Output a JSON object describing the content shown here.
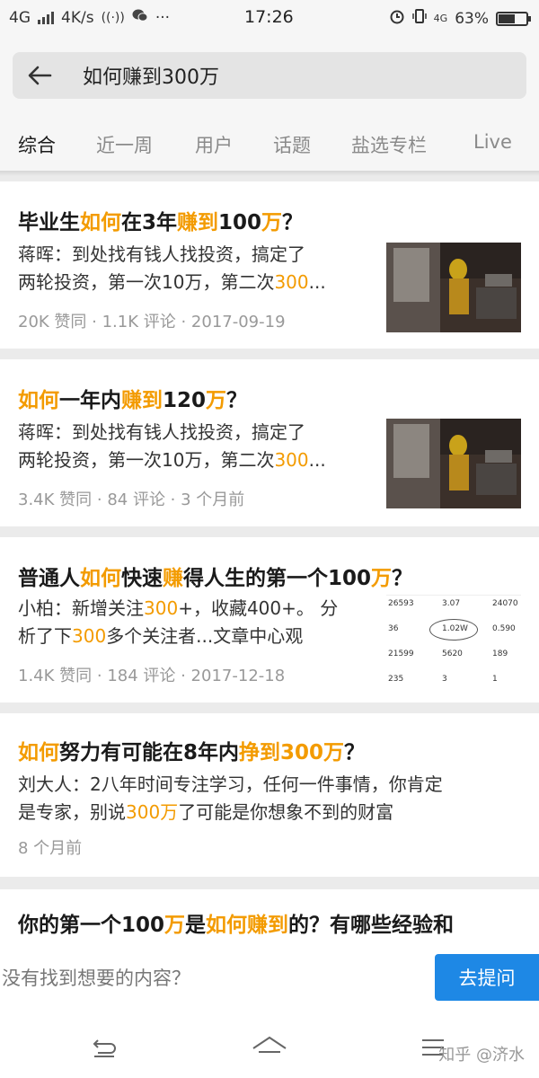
{
  "status_bar": {
    "network": "4G",
    "speed": "4K/s",
    "time": "17:26",
    "mobile_data": "4G",
    "battery_percent": "63%",
    "battery_level": 0.63
  },
  "search": {
    "query": "如何赚到300万"
  },
  "tabs": [
    {
      "label": "综合"
    },
    {
      "label": "近一周"
    },
    {
      "label": "用户"
    },
    {
      "label": "话题"
    },
    {
      "label": "盐选专栏"
    },
    {
      "label": "Live"
    }
  ],
  "results": [
    {
      "title": [
        {
          "t": "毕业生",
          "hl": false
        },
        {
          "t": "如何",
          "hl": true
        },
        {
          "t": "在3年",
          "hl": false
        },
        {
          "t": "赚到",
          "hl": true
        },
        {
          "t": "100",
          "hl": false
        },
        {
          "t": "万",
          "hl": true
        },
        {
          "t": "？",
          "hl": false
        }
      ],
      "excerpt_line1": [
        {
          "t": "蒋晖：到处找有钱人找投资，搞定了",
          "hl": false
        }
      ],
      "excerpt_line2": [
        {
          "t": "两轮投资，第一次10万，第二次",
          "hl": false
        },
        {
          "t": "300",
          "hl": true
        },
        {
          "t": "...",
          "hl": false
        }
      ],
      "meta": "20K 赞同 · 1.1K 评论 · 2017-09-19"
    },
    {
      "title": [
        {
          "t": "如何",
          "hl": true
        },
        {
          "t": "一年内",
          "hl": false
        },
        {
          "t": "赚到",
          "hl": true
        },
        {
          "t": "120",
          "hl": false
        },
        {
          "t": "万",
          "hl": true
        },
        {
          "t": "？",
          "hl": false
        }
      ],
      "excerpt_line1": [
        {
          "t": "蒋晖：到处找有钱人找投资，搞定了",
          "hl": false
        }
      ],
      "excerpt_line2": [
        {
          "t": "两轮投资，第一次10万，第二次",
          "hl": false
        },
        {
          "t": "300",
          "hl": true
        },
        {
          "t": "...",
          "hl": false
        }
      ],
      "meta": "3.4K 赞同 · 84 评论 · 3 个月前"
    },
    {
      "title": [
        {
          "t": "普通人",
          "hl": false
        },
        {
          "t": "如何",
          "hl": true
        },
        {
          "t": "快速",
          "hl": false
        },
        {
          "t": "赚",
          "hl": true
        },
        {
          "t": "得人生的第一个100",
          "hl": false
        },
        {
          "t": "万",
          "hl": true
        },
        {
          "t": "？",
          "hl": false
        }
      ],
      "excerpt_line1": [
        {
          "t": "小柏：新增关注",
          "hl": false
        },
        {
          "t": "300",
          "hl": true
        },
        {
          "t": "+，收藏400+。 分",
          "hl": false
        }
      ],
      "excerpt_line2": [
        {
          "t": "析了下",
          "hl": false
        },
        {
          "t": "300",
          "hl": true
        },
        {
          "t": "多个关注者...文章中心观",
          "hl": false
        }
      ],
      "meta": "1.4K 赞同 · 184 评论 · 2017-12-18",
      "thumb_stats": [
        [
          "26593",
          "3.07",
          "24070"
        ],
        [
          "36",
          "1.02W",
          "0.590"
        ],
        [
          "21599",
          "5620",
          "189"
        ],
        [
          "235",
          "3",
          "1"
        ]
      ]
    },
    {
      "title": [
        {
          "t": "如何",
          "hl": true
        },
        {
          "t": "努力有可能在8年内",
          "hl": false
        },
        {
          "t": "挣到",
          "hl": true
        },
        {
          "t": "300万",
          "hl": true
        },
        {
          "t": "？",
          "hl": false
        }
      ],
      "excerpt_line1": [
        {
          "t": "刘大人：2八年时间专注学习，任何一件事情，你肯定",
          "hl": false
        }
      ],
      "excerpt_line2": [
        {
          "t": "是专家，别说",
          "hl": false
        },
        {
          "t": "300万",
          "hl": true
        },
        {
          "t": "了可能是你想象不到的财富",
          "hl": false
        }
      ],
      "meta": "8 个月前"
    },
    {
      "title": [
        {
          "t": "你的第一个100",
          "hl": false
        },
        {
          "t": "万",
          "hl": true
        },
        {
          "t": "是",
          "hl": false
        },
        {
          "t": "如何赚到",
          "hl": true
        },
        {
          "t": "的？有哪些经验和",
          "hl": false
        }
      ]
    }
  ],
  "prompt": {
    "text": "没有找到想要的内容？",
    "button": "去提问"
  },
  "watermark": "知乎 @济水",
  "colors": {
    "highlight": "#f39b00",
    "accent": "#1e88e5"
  }
}
